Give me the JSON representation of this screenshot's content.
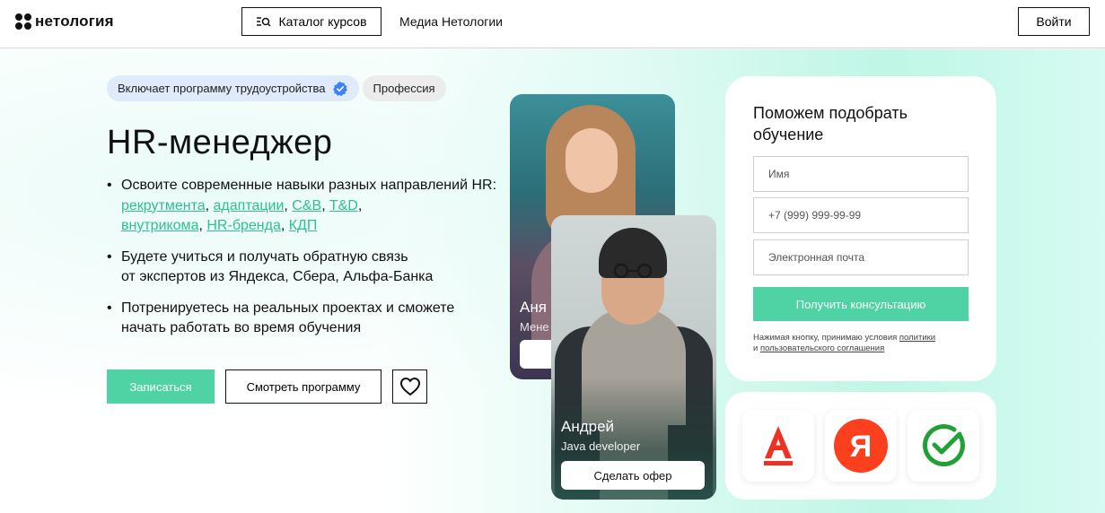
{
  "header": {
    "logo_text": "нетология",
    "catalog_label": "Каталог курсов",
    "media_label": "Медиа Нетологии",
    "login_label": "Войти"
  },
  "badges": {
    "employment": "Включает программу трудоустройства",
    "profession": "Профессия"
  },
  "hero": {
    "title": "HR-менеджер",
    "bullet1_text": "Освоите современные навыки разных   направлений HR: ",
    "bullet1_links": [
      "рекрутмента",
      "адаптации",
      "C&B",
      "T&D",
      "внутрикома",
      "HR-бренда",
      "КДП"
    ],
    "bullet1_seps": [
      ", ",
      ", ",
      ", ",
      ", ",
      ", ",
      ", "
    ],
    "bullet2_line1": "Будете учиться и получать обратную связь",
    "bullet2_line2": "от экспертов из Яндекса, Сбера, Альфа-Банка",
    "bullet3_line1": "Потренируетесь на реальных проектах и сможете",
    "bullet3_line2": "начать работать во время обучения",
    "enroll_label": "Записаться",
    "program_label": "Смотреть программу"
  },
  "cards": {
    "back": {
      "name": "Аня",
      "role": "Мене"
    },
    "front": {
      "name": "Андрей",
      "role": "Java developer",
      "button": "Сделать офер"
    }
  },
  "form": {
    "title": "Поможем подобрать обучение",
    "name_placeholder": "Имя",
    "phone_placeholder": "+7 (999) 999-99-99",
    "email_placeholder": "Электронная почта",
    "submit_label": "Получить консультацию",
    "consent_prefix": "Нажимая кнопку, принимаю условия ",
    "consent_link1": "политики",
    "consent_mid": " и ",
    "consent_link2": "пользовательского соглашения"
  },
  "partners": {
    "alfa_letter": "А",
    "yandex_letter": "Я",
    "alfa_color": "#ef3124",
    "yandex_color": "#fc3f1d",
    "sber_color": "#21a038"
  },
  "colors": {
    "accent": "#4fd3a4",
    "link": "#2fbf93",
    "verified": "#3b82f6"
  }
}
